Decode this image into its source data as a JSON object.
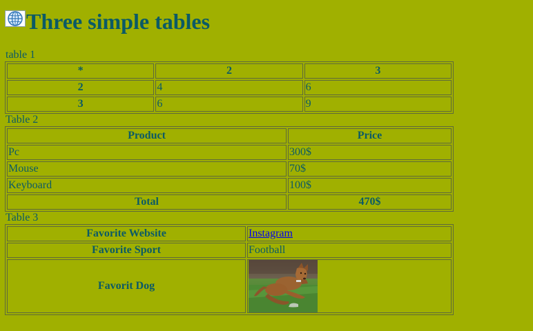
{
  "page": {
    "title": "Three simple tables",
    "icon": "globe-icon"
  },
  "colors": {
    "background": "#a0b000",
    "text": "#0b5a66",
    "link": "#0000ee",
    "border": "#5e6a3a"
  },
  "table1": {
    "caption": "table 1",
    "header": [
      "*",
      "2",
      "3"
    ],
    "rows": [
      {
        "head": "2",
        "cells": [
          "4",
          "6"
        ]
      },
      {
        "head": "3",
        "cells": [
          "6",
          "9"
        ]
      }
    ]
  },
  "table2": {
    "caption": "Table 2",
    "header": [
      "Product",
      "Price"
    ],
    "rows": [
      [
        "Pc",
        "300$"
      ],
      [
        "Mouse",
        "70$"
      ],
      [
        "Keyboard",
        "100$"
      ]
    ],
    "total": {
      "label": "Total",
      "value": "470$"
    }
  },
  "table3": {
    "caption": "Table 3",
    "rows": [
      {
        "label": "Favorite Website",
        "value": "Instagram",
        "type": "link"
      },
      {
        "label": "Favorite Sport",
        "value": "Football",
        "type": "text"
      },
      {
        "label": "Favorit Dog",
        "image": "dog-photo",
        "type": "image"
      }
    ]
  }
}
